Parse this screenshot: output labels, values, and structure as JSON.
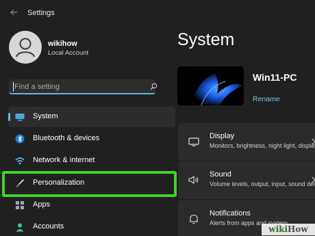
{
  "window": {
    "title": "Settings"
  },
  "user": {
    "name": "wikihow",
    "account_type": "Local Account"
  },
  "search": {
    "placeholder": "Find a setting"
  },
  "nav": {
    "items": [
      {
        "label": "System",
        "icon": "monitor-icon",
        "active": true
      },
      {
        "label": "Bluetooth & devices",
        "icon": "bluetooth-icon"
      },
      {
        "label": "Network & internet",
        "icon": "wifi-icon"
      },
      {
        "label": "Personalization",
        "icon": "paintbrush-icon",
        "highlighted": true
      },
      {
        "label": "Apps",
        "icon": "apps-icon"
      },
      {
        "label": "Accounts",
        "icon": "person-icon"
      }
    ]
  },
  "main": {
    "title": "System",
    "device": {
      "name": "Win11-PC",
      "rename_label": "Rename"
    },
    "cards": [
      {
        "title": "Display",
        "description": "Monitors, brightness, night light, display",
        "icon": "display-icon"
      },
      {
        "title": "Sound",
        "description": "Volume levels, output, input, sound devices",
        "icon": "speaker-icon"
      },
      {
        "title": "Notifications",
        "description": "Alerts from apps and system",
        "icon": "bell-icon"
      }
    ]
  },
  "watermark": {
    "part1": "wiki",
    "part2": "How"
  },
  "colors": {
    "background": "#202020",
    "accent": "#5eb9e0",
    "highlight": "#3fd32e",
    "card": "#2b2b2b"
  }
}
